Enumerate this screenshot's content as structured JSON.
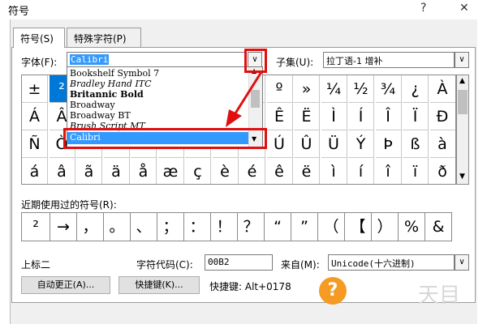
{
  "window": {
    "title": "符号",
    "help_glyph": "?",
    "close_glyph": "✕"
  },
  "tabs": [
    "符号(S)",
    "特殊字符(P)"
  ],
  "font": {
    "label": "字体(F):",
    "value": "Calibri"
  },
  "subset": {
    "label": "子集(U):",
    "value": "拉丁语-1 增补"
  },
  "font_list": {
    "items": [
      "Bookshelf Symbol 7",
      "Bradley Hand ITC",
      "Britannic Bold",
      "Broadway",
      "Broadway BT",
      "Brush Script MT"
    ],
    "selected": "Calibri"
  },
  "symbol_grid": {
    "rows": [
      [
        "±",
        "²",
        "",
        "",
        "",
        "",
        "",
        "",
        "",
        "º",
        "»",
        "¼",
        "½",
        "¾",
        "¿",
        "À"
      ],
      [
        "Á",
        "Â",
        "",
        "",
        "",
        "",
        "",
        "",
        "",
        "Ê",
        "Ë",
        "Ì",
        "Í",
        "Î",
        "Ï",
        "Đ"
      ],
      [
        "Ñ",
        "Ò",
        "",
        "",
        "",
        "",
        "",
        "",
        "",
        "Ú",
        "Û",
        "Ü",
        "Ý",
        "Þ",
        "ß",
        "à"
      ],
      [
        "á",
        "â",
        "ã",
        "ä",
        "å",
        "æ",
        "ç",
        "è",
        "é",
        "ê",
        "ë",
        "ì",
        "í",
        "î",
        "ï",
        "ð"
      ]
    ],
    "selected_row": 0,
    "selected_col": 1
  },
  "recent": {
    "label": "近期使用过的符号(R):",
    "symbols": [
      "²",
      "→",
      "，",
      "。",
      "、",
      "；",
      "：",
      "！",
      "？",
      "“",
      "”",
      "（",
      "【",
      "）",
      "%",
      "&"
    ]
  },
  "char_name": "上标二",
  "char_code": {
    "label": "字符代码(C):",
    "value": "00B2"
  },
  "from": {
    "label": "来自(M):",
    "value": "Unicode(十六进制)"
  },
  "buttons": {
    "autocorrect": "自动更正(A)...",
    "shortcut_key": "快捷键(K)..."
  },
  "shortcut": {
    "text": "快捷键: Alt+0178"
  },
  "colors": {
    "accent": "#0078d7",
    "highlight": "#e01010",
    "selection": "#3399ff"
  },
  "watermark": {
    "glyph": "?",
    "text": "天目"
  }
}
